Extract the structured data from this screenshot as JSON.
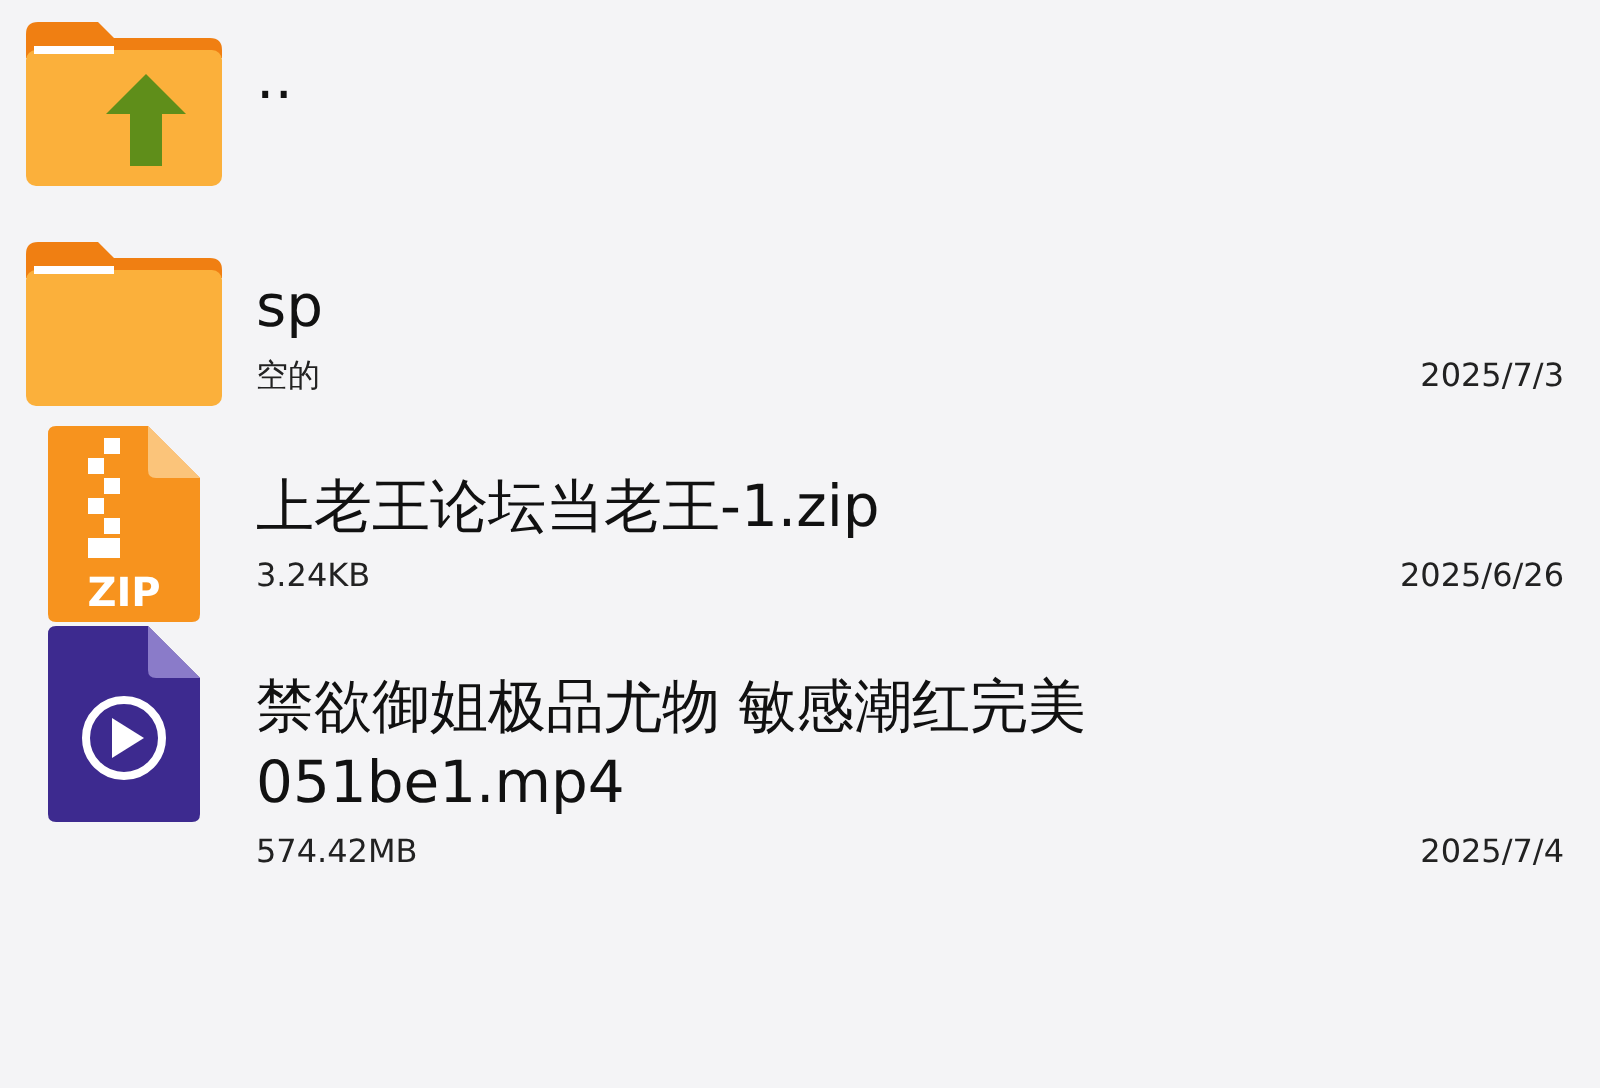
{
  "files": [
    {
      "kind": "parent",
      "name": ".."
    },
    {
      "kind": "folder",
      "name": "sp",
      "info": "空的",
      "date": "2025/7/3"
    },
    {
      "kind": "zip",
      "name": "上老王论坛当老王-1.zip",
      "info": "3.24KB",
      "date": "2025/6/26",
      "badge": "ZIP"
    },
    {
      "kind": "video",
      "name": "禁欲御姐极品尤物 敏感潮红完美051be1.mp4",
      "info": "574.42MB",
      "date": "2025/7/4"
    }
  ]
}
